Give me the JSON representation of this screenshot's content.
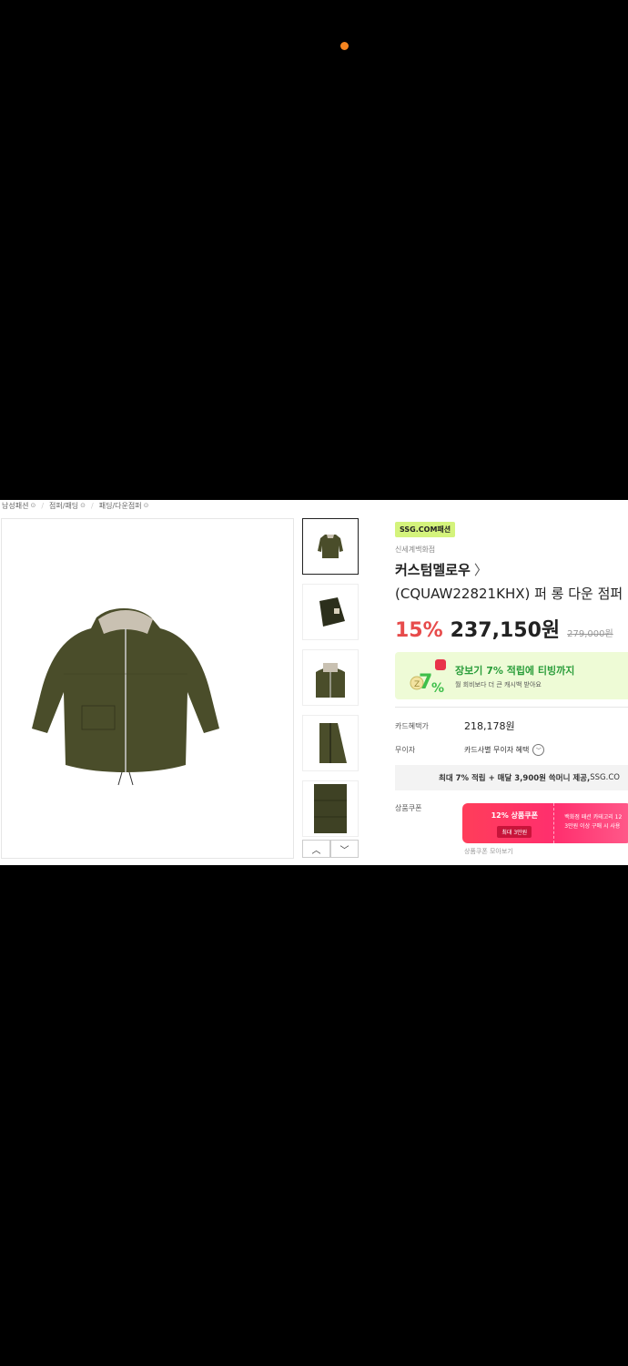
{
  "breadcrumbs": [
    "남성패션",
    "점퍼/패딩",
    "패딩/다운점퍼"
  ],
  "badge": "SSG.COM패션",
  "store": "신세계백화점",
  "brand": "커스텀멜로우",
  "product_title": "(CQUAW22821KHX) 퍼 롱 다운 점퍼",
  "price": {
    "discount": "15%",
    "sale": "237,150원",
    "original": "279,000원"
  },
  "promo": {
    "title": "장보기 7% 적립에 티빙까지",
    "subtitle": "월 회비보다 더 큰 캐시백 받아요",
    "icon_text": "7%"
  },
  "card_benefit": {
    "label": "카드혜택가",
    "value": "218,178원"
  },
  "installment": {
    "label": "무이자",
    "value": "카드사별 무이자 혜택"
  },
  "notice": {
    "bold": "최대 7% 적립 + 매달 3,900원 쓱머니 제공,",
    "rest": " SSG.CO"
  },
  "coupon": {
    "label": "상품쿠폰",
    "title": "12% 상품쿠폰",
    "max": "최대 3만원",
    "desc_line1": "백화점 패션 카테고리 12",
    "desc_line2": "3만원 이상 구매 시 사용",
    "more": "상품쿠폰 모아보기"
  },
  "colors": {
    "discount": "#e74b4b",
    "badge": "#d4f37c",
    "promo_bg": "#eefbd6",
    "promo_text": "#2a9d3a",
    "coupon": "#ff3d5a",
    "jacket": "#4a4d2a"
  },
  "icons": [
    "chevron-down-circle-icon",
    "chevron-right-icon",
    "arrow-up-icon",
    "arrow-down-icon",
    "status-dot-icon"
  ]
}
